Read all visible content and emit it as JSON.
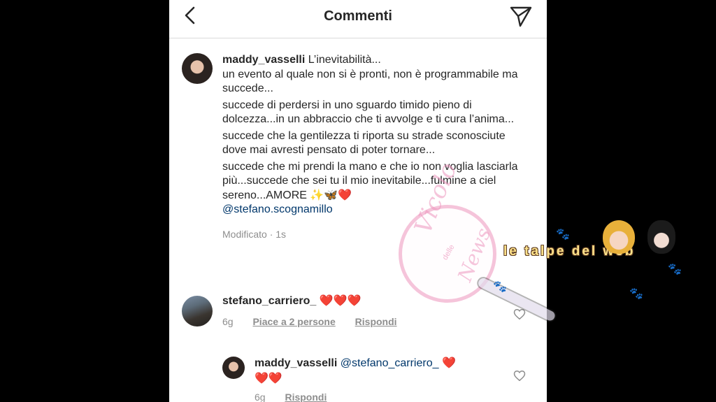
{
  "header": {
    "title": "Commenti",
    "back_icon": "chevron-left-icon",
    "send_icon": "paper-plane-icon"
  },
  "caption": {
    "username": "maddy_vasselli",
    "lines": [
      "L’inevitabilità...",
      "un evento al quale non si è pronti, non è programmabile ma succede...",
      "succede di perdersi in uno sguardo timido pieno di dolcezza...in un abbraccio che ti avvolge e ti cura l’anima...",
      "succede che la gentilezza ti riporta su strade sconosciute dove mai avresti pensato di poter tornare...",
      "succede che mi prendi la mano e che io non voglia lasciarla più...succede che sei tu il mio inevitabile...fulmine a ciel sereno...AMORE",
      "✨🦋❤️"
    ],
    "mention": "@stefano.scognamillo",
    "meta": "Modificato · 1s"
  },
  "comments": [
    {
      "username": "stefano_carriero_",
      "text": "❤️❤️❤️",
      "time": "6g",
      "likes": "Piace a 2 persone",
      "reply": "Rispondi"
    },
    {
      "username": "maddy_vasselli",
      "mention": "@stefano_carriero_",
      "text": "❤️",
      "text2": "❤️❤️",
      "time": "6g",
      "reply": "Rispondi"
    }
  ],
  "watermark": {
    "script_top": "Vicolo",
    "small": "delle",
    "script_bottom": "News",
    "label": "le talpe del web"
  },
  "colors": {
    "text": "#262626",
    "secondary": "#8e8e8e",
    "mention": "#00376b",
    "heart": "#ed2a2a",
    "divider": "#dbdbdb"
  }
}
